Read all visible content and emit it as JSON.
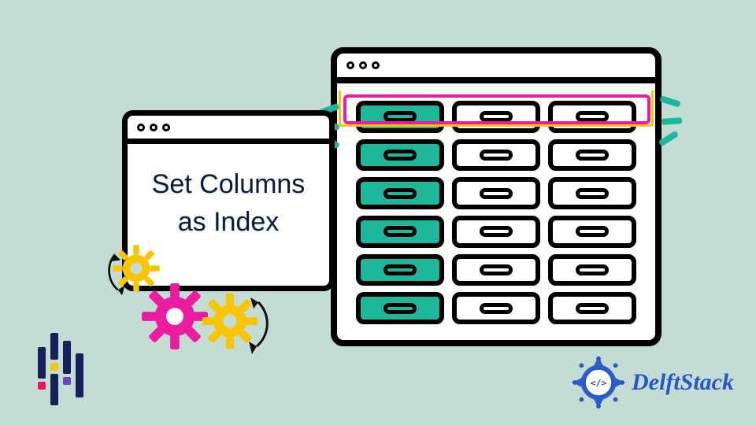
{
  "title": {
    "line1": "Set Columns",
    "line2": "as Index"
  },
  "brand": {
    "name": "DelftStack"
  },
  "colors": {
    "background": "#c3ddd4",
    "teal": "#1db89a",
    "magenta": "#ec1ca0",
    "yellow": "#f7c600",
    "blue": "#2656c9",
    "navy": "#0e1c3a"
  },
  "table": {
    "rows": 6,
    "cols": 3,
    "index_column": 0,
    "highlighted_row": 0
  },
  "gears": [
    {
      "color": "yellow",
      "size": "small"
    },
    {
      "color": "magenta",
      "size": "large"
    },
    {
      "color": "yellow",
      "size": "medium"
    }
  ],
  "icons": {
    "window_controls": 3
  }
}
